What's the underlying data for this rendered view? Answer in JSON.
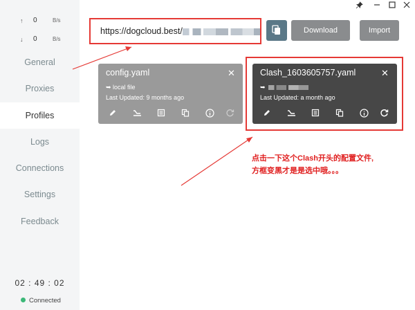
{
  "window": {
    "pin_icon": "pin-icon",
    "minimize_icon": "minimize-icon",
    "maximize_icon": "maximize-icon",
    "close_icon": "close-icon"
  },
  "sidebar": {
    "upload": {
      "arrow": "↑",
      "value": "0",
      "unit": "B/s"
    },
    "download": {
      "arrow": "↓",
      "value": "0",
      "unit": "B/s"
    },
    "items": [
      {
        "label": "General"
      },
      {
        "label": "Proxies"
      },
      {
        "label": "Profiles"
      },
      {
        "label": "Logs"
      },
      {
        "label": "Connections"
      },
      {
        "label": "Settings"
      },
      {
        "label": "Feedback"
      }
    ],
    "active_index": 2,
    "clock": "02 : 49 : 02",
    "status": "Connected",
    "status_color": "#3cb878"
  },
  "toolbar": {
    "url_value": "https://dogcloud.best/",
    "paste_icon": "paste-icon",
    "download_label": "Download",
    "import_label": "Import"
  },
  "profiles": [
    {
      "name": "config.yaml",
      "source": "➥ local file",
      "updated": "Last Updated: 9 months ago",
      "selected": false,
      "bg": "#9a9a9a"
    },
    {
      "name": "Clash_1603605757.yaml",
      "source": "➥",
      "updated": "Last Updated: a month ago",
      "selected": true,
      "bg": "#474747"
    }
  ],
  "annotation": {
    "line1": "点击一下这个Clash开头的配置文件,",
    "line2": "方框变黑才是是选中哦。。。",
    "color": "#e02020"
  }
}
